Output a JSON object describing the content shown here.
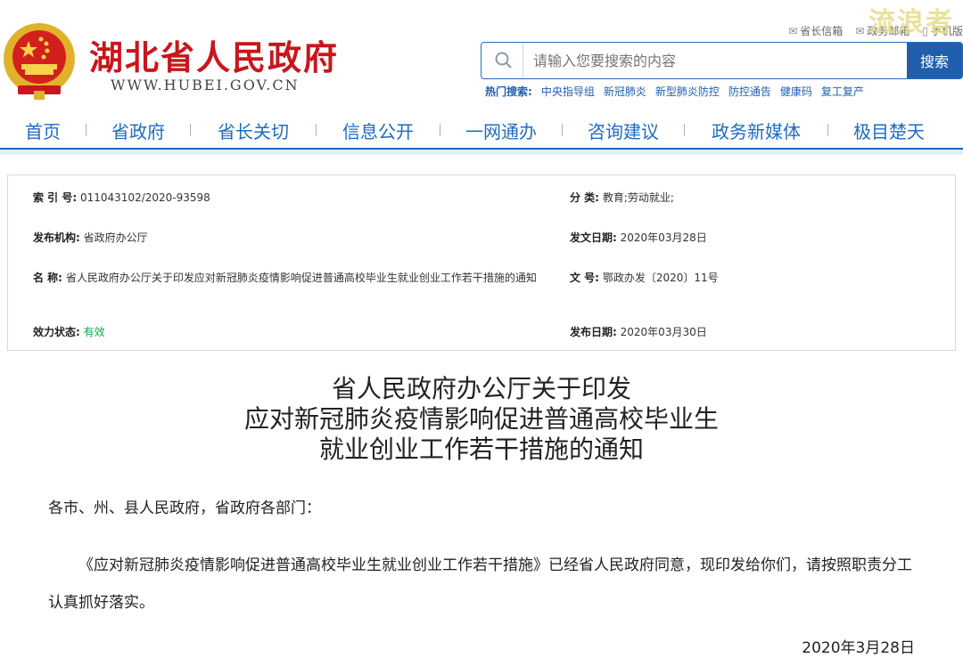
{
  "header": {
    "site_title": "湖北省人民政府",
    "site_url": "WWW.HUBEI.GOV.CN",
    "watermark": "流浪者",
    "toplinks": [
      {
        "label": "省长信箱",
        "icon": "mail-icon"
      },
      {
        "label": "政务邮箱",
        "icon": "envelope-icon"
      },
      {
        "label": "手机版",
        "icon": "mobile-icon"
      }
    ]
  },
  "search": {
    "placeholder": "请输入您要搜索的内容",
    "button_label": "搜索",
    "hot_label": "热门搜索:",
    "hot_items": [
      "中央指导组",
      "新冠肺炎",
      "新型肺炎防控",
      "防控通告",
      "健康码",
      "复工复产"
    ]
  },
  "nav": {
    "items": [
      "首页",
      "省政府",
      "省长关切",
      "信息公开",
      "一网通办",
      "咨询建议",
      "政务新媒体",
      "极目楚天"
    ]
  },
  "meta": {
    "index_label": "索 引 号:",
    "index_value": "011043102/2020-93598",
    "category_label": "分 类:",
    "category_value": "教育;劳动就业;",
    "publisher_label": "发布机构:",
    "publisher_value": "省政府办公厅",
    "issue_date_label": "发文日期:",
    "issue_date_value": "2020年03月28日",
    "name_label": "名 称:",
    "name_value": "省人民政府办公厅关于印发应对新冠肺炎疫情影响促进普通高校毕业生就业创业工作若干措施的通知",
    "docno_label": "文 号:",
    "docno_value": "鄂政办发〔2020〕11号",
    "status_label": "效力状态:",
    "status_value": "有效",
    "publish_date_label": "发布日期:",
    "publish_date_value": "2020年03月30日"
  },
  "article": {
    "title_lines": [
      "省人民政府办公厅关于印发",
      "应对新冠肺炎疫情影响促进普通高校毕业生",
      "就业创业工作若干措施的通知"
    ],
    "salutation": "各市、州、县人民政府，省政府各部门：",
    "paragraph": "《应对新冠肺炎疫情影响促进普通高校毕业生就业创业工作若干措施》已经省人民政府同意，现印发给你们，请按照职责分工认真抓好落实。",
    "date": "2020年3月28日"
  },
  "colors": {
    "brand_red": "#c8161d",
    "nav_blue": "#1f6bbf",
    "button_blue": "#1f5fad",
    "status_green": "#12a34a"
  }
}
